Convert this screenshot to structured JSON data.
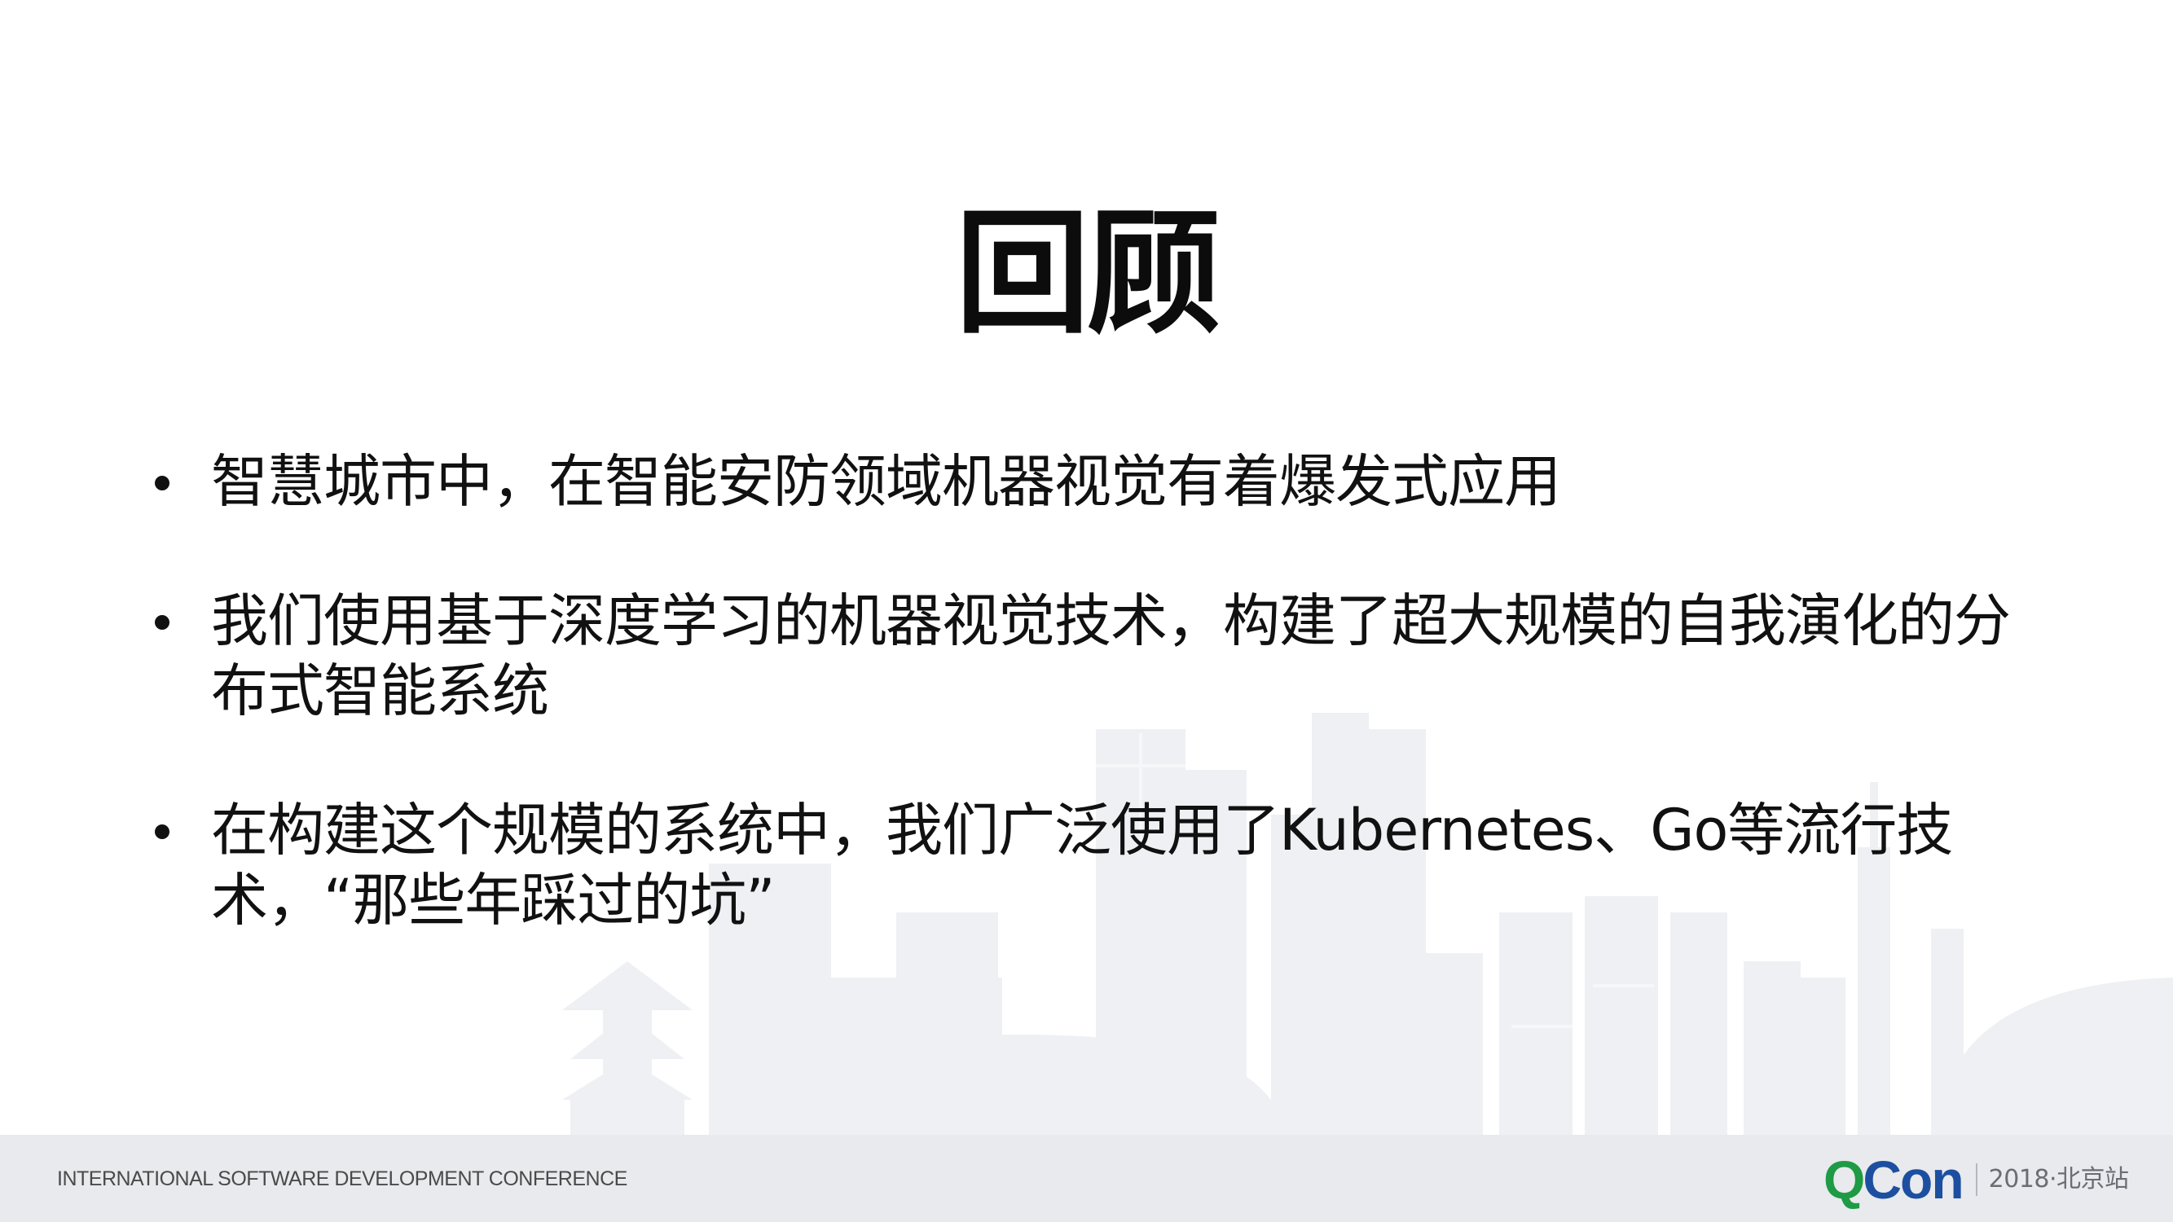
{
  "slide": {
    "title": "回顾",
    "bullets": [
      "智慧城市中，在智能安防领域机器视觉有着爆发式应用",
      "我们使用基于深度学习的机器视觉技术，构建了超大规模的自我演化的分布式智能系统",
      "在构建这个规模的系统中，我们广泛使用了Kubernetes、Go等流行技术，“那些年踩过的坑”"
    ]
  },
  "footer": {
    "conference": "INTERNATIONAL SOFTWARE DEVELOPMENT CONFERENCE",
    "logo_q": "Q",
    "logo_con": "Con",
    "edition": "2018·北京站"
  },
  "colors": {
    "background": "#ffffff",
    "footer_bar": "#e8eaed",
    "skyline": "#eef0f3",
    "logo_green": "#1f9a45",
    "logo_blue": "#1d4fa0",
    "text": "#111111"
  },
  "icons": [
    "bullet-dot",
    "city-skyline-illustration",
    "qcon-logo"
  ]
}
